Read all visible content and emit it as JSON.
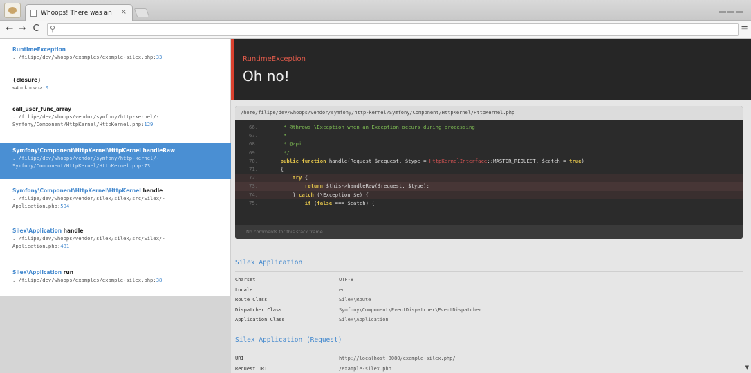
{
  "browser": {
    "tab_title": "Whoops! There was an",
    "tab_close": "×",
    "back": "←",
    "forward": "→",
    "reload": "C",
    "search_icon": "⚲",
    "menu_icon": "≡"
  },
  "frames": [
    {
      "class": "RuntimeException",
      "fn": "",
      "path": "../filipe/dev/whoops/examples/example-silex.php:",
      "line": "33",
      "active": false
    },
    {
      "class": "",
      "fn": "{closure}",
      "path": "<#unknown>:",
      "line": "0",
      "active": false
    },
    {
      "class": "",
      "fn": "call_user_func_array",
      "path": "../filipe/dev/whoops/vendor/symfony/http-kernel/-\nSymfony/Component/HttpKernel/HttpKernel.php:",
      "line": "129",
      "active": false
    },
    {
      "class": "Symfony\\Component\\HttpKernel\\HttpKernel",
      "fn": " handleRaw",
      "path": "../filipe/dev/whoops/vendor/symfony/http-kernel/-\nSymfony/Component/HttpKernel/HttpKernel.php:",
      "line": "73",
      "active": true
    },
    {
      "class": "Symfony\\Component\\HttpKernel\\HttpKernel",
      "fn": " handle",
      "path": "../filipe/dev/whoops/vendor/silex/silex/src/Silex/-\nApplication.php:",
      "line": "504",
      "active": false
    },
    {
      "class": "Silex\\Application",
      "fn": " handle",
      "path": "../filipe/dev/whoops/vendor/silex/silex/src/Silex/-\nApplication.php:",
      "line": "481",
      "active": false
    },
    {
      "class": "Silex\\Application",
      "fn": " run",
      "path": "../filipe/dev/whoops/examples/example-silex.php:",
      "line": "38",
      "active": false
    }
  ],
  "exception": {
    "type": "RuntimeException",
    "message": "Oh no!"
  },
  "code": {
    "file": "/home/filipe/dev/whoops/vendor/symfony/http-kernel/Symfony/Component/HttpKernel/HttpKernel.php",
    "comments_placeholder": "No comments for this stack frame."
  },
  "silex_application": {
    "title": "Silex Application",
    "rows": [
      {
        "key": "Charset",
        "value": "UTF-8"
      },
      {
        "key": "Locale",
        "value": "en"
      },
      {
        "key": "Route Class",
        "value": "Silex\\Route"
      },
      {
        "key": "Dispatcher Class",
        "value": "Symfony\\Component\\EventDispatcher\\EventDispatcher"
      },
      {
        "key": "Application Class",
        "value": "Silex\\Application"
      }
    ]
  },
  "silex_request": {
    "title": "Silex Application (Request)",
    "rows": [
      {
        "key": "URI",
        "value": "http://localhost:8080/example-silex.php/"
      },
      {
        "key": "Request URI",
        "value": "/example-silex.php"
      }
    ]
  },
  "colors": {
    "accent": "#4288ce",
    "error": "#d9412f",
    "active_frame": "#4a8fd3",
    "code_bg": "#2b2b2b"
  }
}
